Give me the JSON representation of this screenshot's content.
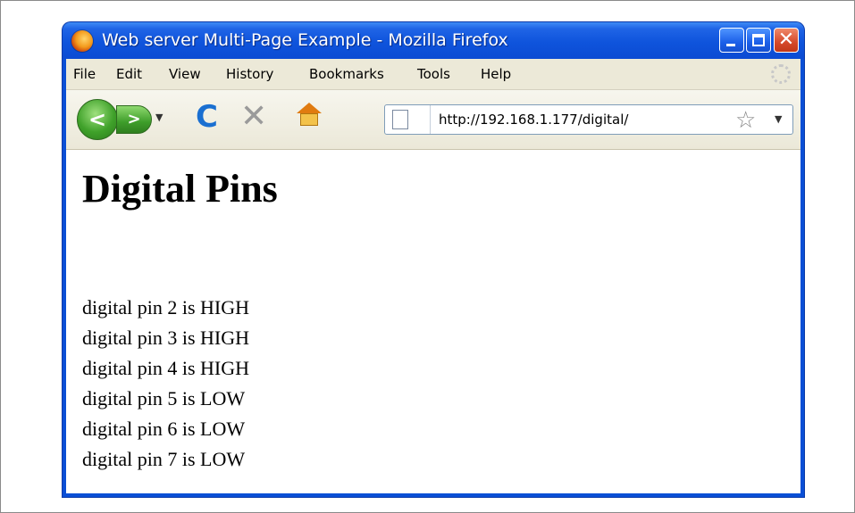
{
  "window": {
    "title": "Web server Multi-Page Example - Mozilla Firefox",
    "controls": {
      "minimize": "minimize",
      "maximize": "maximize",
      "close": "close"
    }
  },
  "menu": {
    "items": [
      {
        "label": "File"
      },
      {
        "label": "Edit"
      },
      {
        "label": "View"
      },
      {
        "label": "History"
      },
      {
        "label": "Bookmarks"
      },
      {
        "label": "Tools"
      },
      {
        "label": "Help"
      }
    ]
  },
  "navigation": {
    "back_icon": "back-arrow-icon",
    "forward_icon": "forward-arrow-icon",
    "reload_icon": "reload-icon",
    "stop_icon": "stop-icon",
    "home_icon": "home-icon",
    "url": "http://192.168.1.177/digital/"
  },
  "page": {
    "heading": "Digital Pins",
    "pins": [
      "digital pin 2 is HIGH",
      "digital pin 3 is HIGH",
      "digital pin 4 is HIGH",
      "digital pin 5 is LOW",
      "digital pin 6 is LOW",
      "digital pin 7 is LOW"
    ]
  },
  "colors": {
    "titlebar": "#0f54dc",
    "chrome": "#ece9d8",
    "close_button": "#d5492a",
    "nav_button": "#3fa12a"
  }
}
